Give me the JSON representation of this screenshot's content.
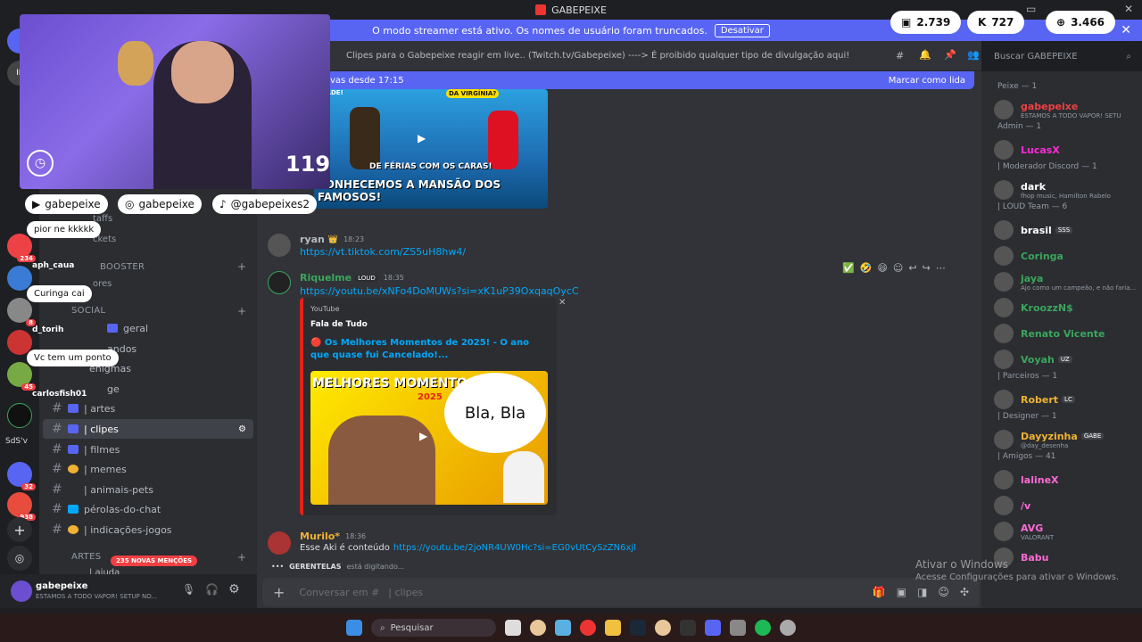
{
  "titlebar": {
    "title": "GABEPEIXE"
  },
  "banner": {
    "text": "O modo streamer está ativo. Os nomes de usuário foram truncados.",
    "button": "Desativar"
  },
  "stats": [
    {
      "icon": "twitch-icon",
      "value": "2.739"
    },
    {
      "icon": "kick-icon",
      "value": "727"
    },
    {
      "icon": "globe-icon",
      "value": "3.466"
    }
  ],
  "webcam": {
    "number": "119"
  },
  "socials": [
    {
      "icon": "youtube-icon",
      "handle": "gabepeixe"
    },
    {
      "icon": "instagram-icon",
      "handle": "gabepeixe"
    },
    {
      "icon": "tiktok-icon",
      "handle": "@gabepeixes2"
    }
  ],
  "overlay_chat": [
    {
      "name": "",
      "text": "pior ne kkkkk"
    },
    {
      "name": "aph_caua",
      "text": "Curinga cai"
    },
    {
      "name": "d_torih",
      "text": "Vc tem um ponto"
    },
    {
      "name": "carlosfish01",
      "text": ""
    }
  ],
  "servers": {
    "badges": [
      "234",
      "46",
      "8",
      "45",
      "32",
      "938"
    ],
    "labels": [
      "IF",
      "SdS'v"
    ]
  },
  "sidebar": {
    "partial": [
      "taffs",
      "ckets",
      "ores"
    ],
    "categories": {
      "booster": "BOOSTER",
      "social": "SOCIAL",
      "artes": "ARTES"
    },
    "channels": [
      {
        "label": "geral"
      },
      {
        "label": "andos"
      },
      {
        "label": "enigmas"
      },
      {
        "label": "ge"
      },
      {
        "label": "| artes"
      },
      {
        "label": "| clipes"
      },
      {
        "label": "| filmes"
      },
      {
        "label": "| memes"
      },
      {
        "label": "| animais-pets"
      },
      {
        "label": "pérolas-do-chat"
      },
      {
        "label": "| indicações-jogos"
      },
      {
        "label": "| ajuda"
      }
    ],
    "mentions": "235 NOVAS MENÇÕES"
  },
  "user": {
    "name": "gabepeixe",
    "status": "ESTAMOS A TODO VAPOR! SETUP NO..."
  },
  "header": {
    "topic": "Clipes para o Gabepeixe reagir em live.. (Twitch.tv/Gabepeixe) ----> É proibido qualquer tipo de divulgação aqui!",
    "search_placeholder": "Buscar GABEPEIXE"
  },
  "newbar": {
    "left": "vas desde 17:15",
    "right": "Marcar como lida"
  },
  "thumb1": {
    "line1": "DE FÉRIAS COM OS CARAS!",
    "line2": "CONHECEMOS A MANSÃO DOS FAMOSOS!",
    "tag": "DA VIRGÍNIA?",
    "tag2": "CIDADE!"
  },
  "messages": [
    {
      "name": "ryan",
      "time": "18:23",
      "link": "https://vt.tiktok.com/ZS5uH8hw4/"
    },
    {
      "name": "Riquelme",
      "badge": "LOUD",
      "time": "18:35",
      "link": "https://youtu.be/xNFo4DoMUWs?si=xK1uP39OxqaqOycC"
    },
    {
      "name": "Murilo*",
      "time": "18:36",
      "text": "Esse Aki é conteúdo",
      "link": "https://youtu.be/2joNR4UW0Hc?si=EG0vUtCySzZN6xjI"
    }
  ],
  "embed": {
    "provider": "YouTube",
    "author": "Fala de Tudo",
    "title": "🔴 Os Melhores Momentos de 2025! - O ano que quase fui Cancelado!...",
    "thumb_title": "MELHORES MOMENTOS",
    "thumb_year": "2025",
    "bubble": "Bla, Bla"
  },
  "typing": {
    "user": "GERENTELAS",
    "text": "está digitando..."
  },
  "input": {
    "placeholder": "Conversar em #",
    "channel": "| clipes"
  },
  "members": [
    {
      "role": "Peixe — 1"
    },
    {
      "name": "gabepeixe",
      "status": "ESTAMOS A TODO VAPOR! SETU",
      "color": "#f23f43"
    },
    {
      "role": "Admin — 1"
    },
    {
      "name": "LucasX",
      "color": "#ff2bd6"
    },
    {
      "role": "| Moderador Discord — 1"
    },
    {
      "name": "dark",
      "status": "fhop music, Hamilton Rabelo",
      "color": "#ffffff"
    },
    {
      "role": "| LOUD Team — 6"
    },
    {
      "name": "brasil",
      "tag": "SSS",
      "color": "#ffffff"
    },
    {
      "name": "Coringa",
      "color": "#3ba55d"
    },
    {
      "name": "jaya",
      "status": "Ajo como um campeão, e não faria...",
      "color": "#3ba55d"
    },
    {
      "name": "KroozzN$",
      "color": "#3ba55d"
    },
    {
      "name": "Renato Vicente",
      "color": "#3ba55d"
    },
    {
      "name": "Voyah",
      "tag": "UZ",
      "color": "#3ba55d"
    },
    {
      "role": "| Parceiros — 1"
    },
    {
      "name": "Robert",
      "tag": "LC",
      "color": "#f0b232"
    },
    {
      "role": "| Designer — 1"
    },
    {
      "name": "Dayyzinha",
      "tag": "GABE",
      "status": "@day_desenha",
      "color": "#f0b232"
    },
    {
      "role": "| Amigos — 41"
    },
    {
      "name": "lalineX",
      "color": "#ff6ad5"
    },
    {
      "name": "/v",
      "color": "#ff6ad5"
    },
    {
      "name": "AVG",
      "status": "VALORANT",
      "color": "#ff6ad5"
    },
    {
      "name": "Babu",
      "color": "#ff6ad5"
    }
  ],
  "windows_watermark": {
    "line1": "Ativar o Windows",
    "line2": "Acesse Configurações para ativar o Windows."
  },
  "taskbar": {
    "search": "Pesquisar"
  }
}
